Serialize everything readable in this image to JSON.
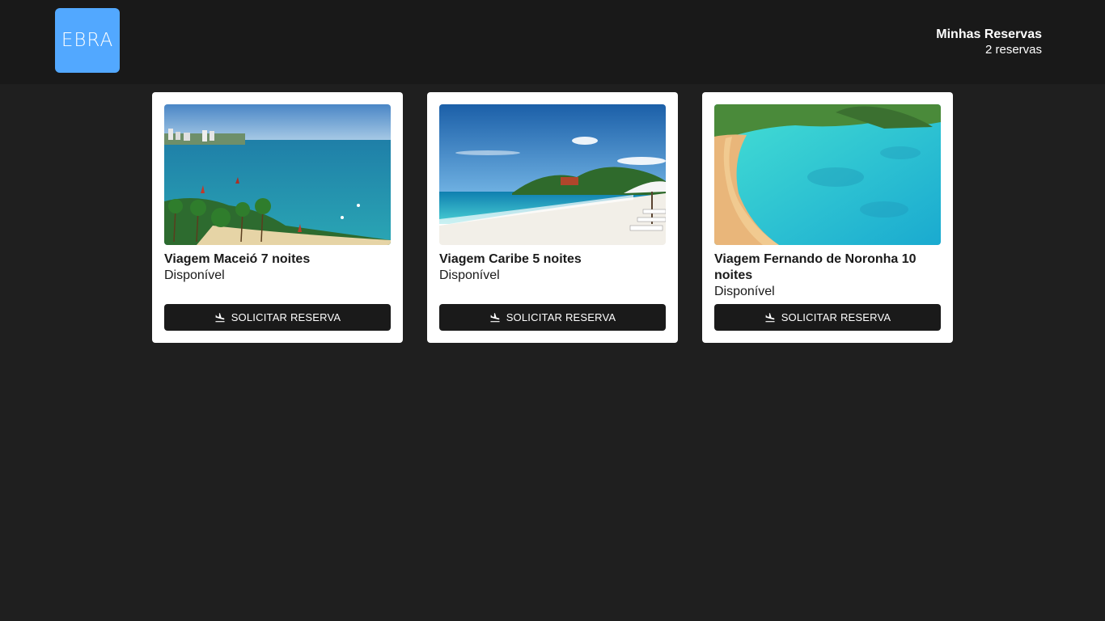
{
  "header": {
    "logo_text": "EBRA",
    "reservations_title": "Minhas Reservas",
    "reservations_count": "2 reservas"
  },
  "cards": [
    {
      "title": "Viagem Maceió 7 noites",
      "status": "Disponível",
      "button_label": "SOLICITAR RESERVA",
      "button_icon": "flight-land-icon"
    },
    {
      "title": "Viagem Caribe 5 noites",
      "status": "Disponível",
      "button_label": "SOLICITAR RESERVA",
      "button_icon": "flight-land-icon"
    },
    {
      "title": "Viagem Fernando de Noronha 10 noites",
      "status": "Disponível",
      "button_label": "SOLICITAR RESERVA",
      "button_icon": "flight-land-icon"
    }
  ],
  "colors": {
    "background": "#1f1f1f",
    "header": "#191919",
    "logo": "#52a8ff",
    "button": "#1a1a1a"
  }
}
